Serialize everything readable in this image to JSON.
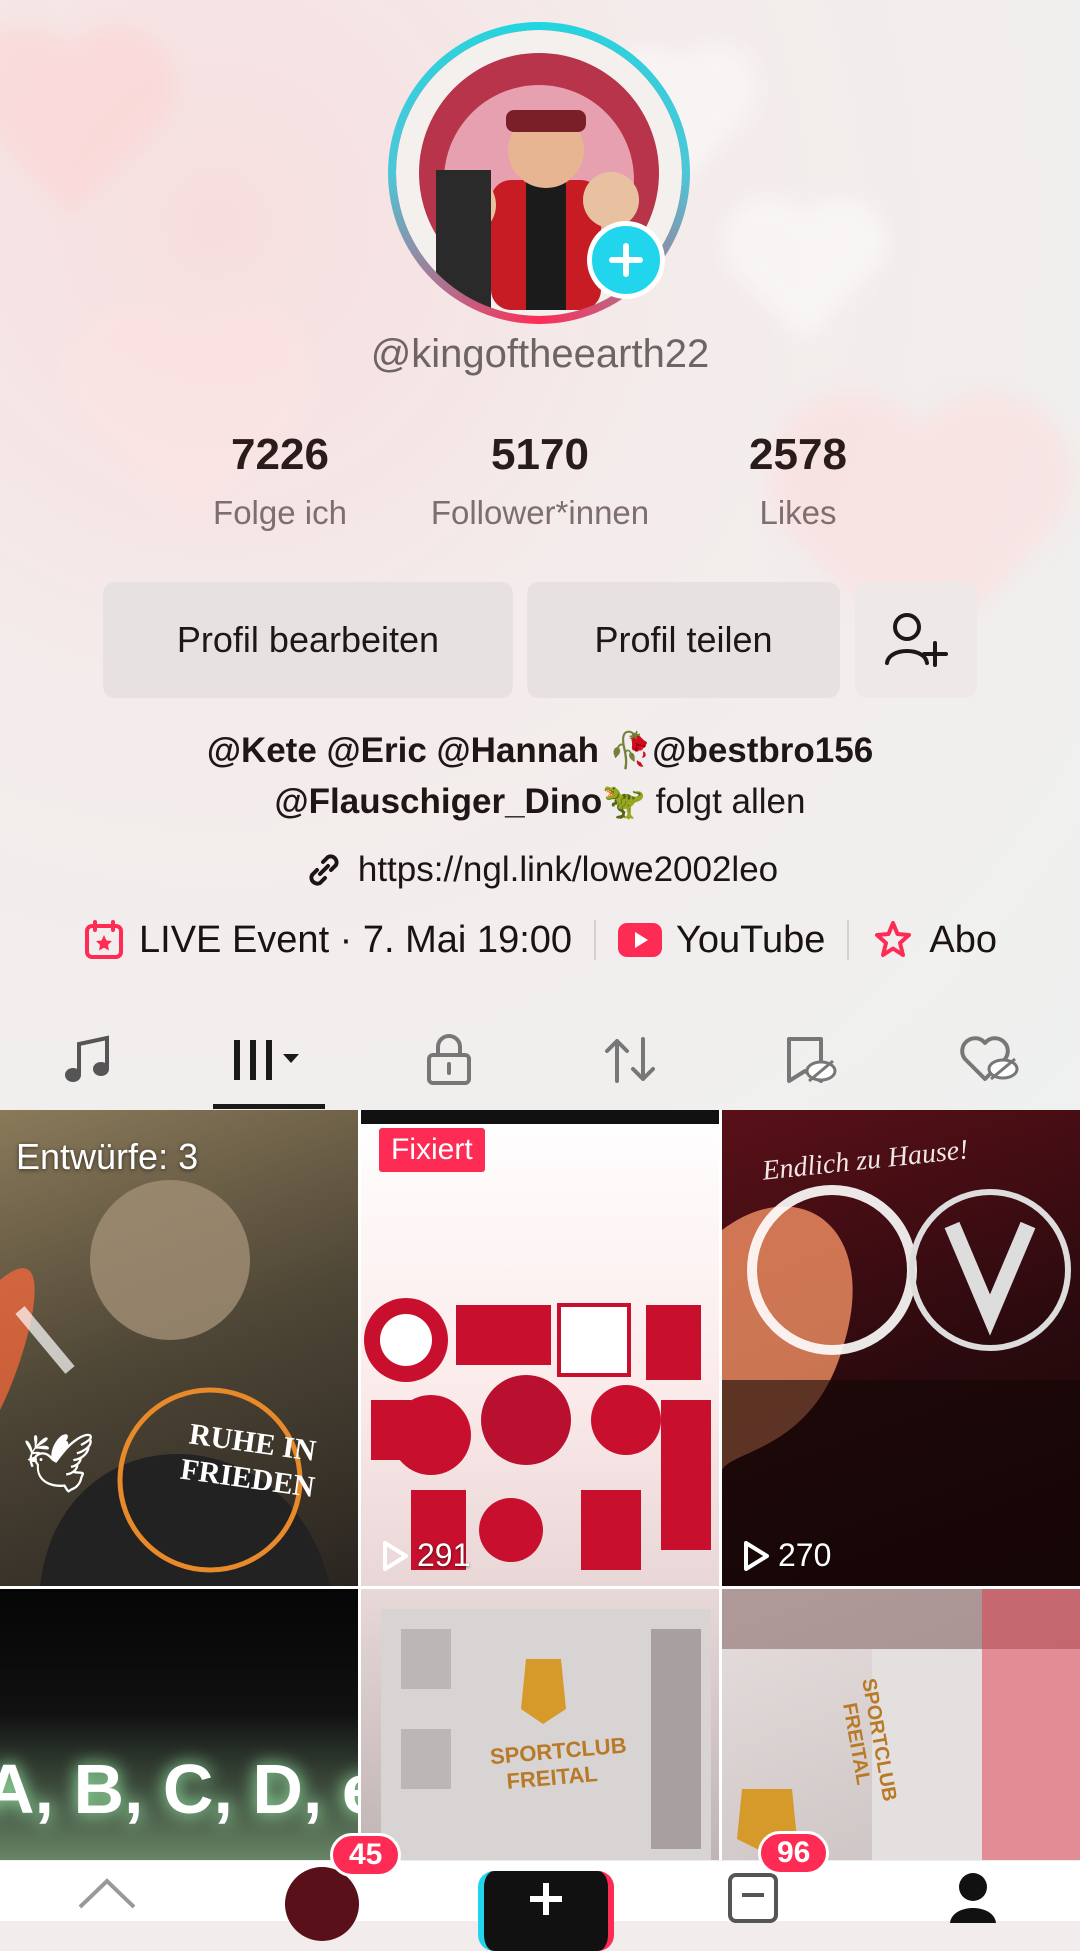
{
  "profile": {
    "username": "@kingoftheearth22",
    "stats": [
      {
        "value": "7226",
        "label": "Folge ich"
      },
      {
        "value": "5170",
        "label": "Follower*innen"
      },
      {
        "value": "2578",
        "label": "Likes"
      }
    ],
    "buttons": {
      "edit": "Profil bearbeiten",
      "share": "Profil teilen"
    },
    "bio_line1": "@Kete @Eric @Hannah 🥀@bestbro156",
    "bio_line2_handle": "@Flauschiger_Dino",
    "bio_line2_emoji": "🦖",
    "bio_line2_rest": " folgt allen",
    "link": "https://ngl.link/lowe2002leo",
    "events": {
      "live": "LIVE Event · 7. Mai 19:00",
      "youtube": "YouTube",
      "abo": "Abo"
    }
  },
  "tabs": [
    "music-tab",
    "videos-tab",
    "private-tab",
    "reposts-tab",
    "saved-hidden-tab",
    "liked-hidden-tab"
  ],
  "grid": {
    "drafts_label": "Entwürfe: 3",
    "pinned_label": "Fixiert",
    "cell2_views": "291",
    "cell3_views": "270",
    "cell1_text": "RUHE IN FRIEDEN",
    "cell3_text": "Endlich zu Hause!",
    "cell4_text": "A, B, C, D, e",
    "cell5_text": "SPORTCLUB FREITAL",
    "cell6_text": "SPORTCLUB FREITAL"
  },
  "nav": {
    "inbox_badge": "45",
    "messages_badge": "96"
  },
  "colors": {
    "accent": "#fe2c55",
    "cyan": "#20d5ec"
  }
}
